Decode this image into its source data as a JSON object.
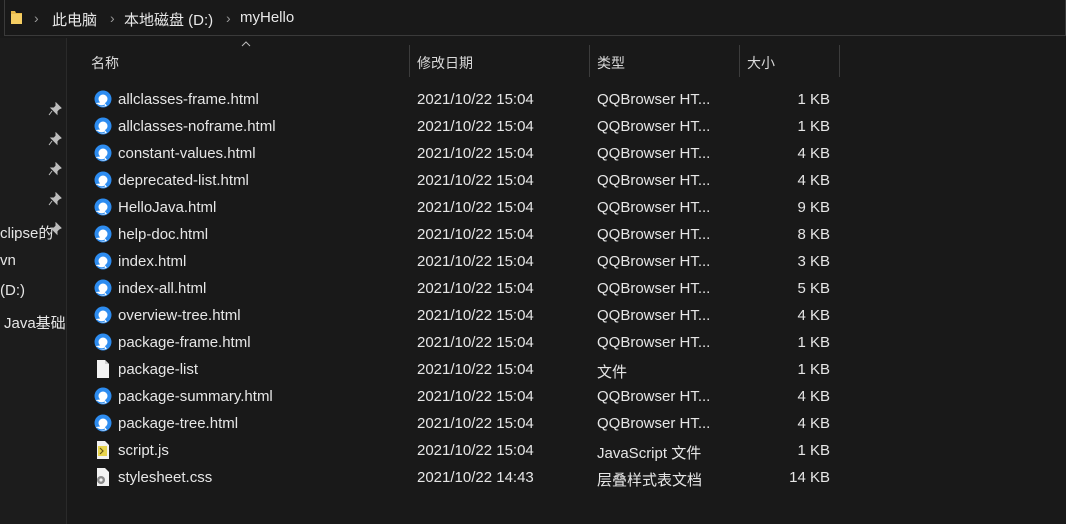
{
  "breadcrumb": [
    "此电脑",
    "本地磁盘 (D:)",
    "myHello"
  ],
  "nav_pane": {
    "items": [
      "clipse的",
      "vn",
      "(D:)",
      "Java基础."
    ]
  },
  "columns": {
    "name": "名称",
    "date": "修改日期",
    "type": "类型",
    "size": "大小"
  },
  "files": [
    {
      "name": "allclasses-frame.html",
      "date": "2021/10/22 15:04",
      "type": "QQBrowser HT...",
      "size": "1 KB",
      "icon": "qqbrowser-html-icon"
    },
    {
      "name": "allclasses-noframe.html",
      "date": "2021/10/22 15:04",
      "type": "QQBrowser HT...",
      "size": "1 KB",
      "icon": "qqbrowser-html-icon"
    },
    {
      "name": "constant-values.html",
      "date": "2021/10/22 15:04",
      "type": "QQBrowser HT...",
      "size": "4 KB",
      "icon": "qqbrowser-html-icon"
    },
    {
      "name": "deprecated-list.html",
      "date": "2021/10/22 15:04",
      "type": "QQBrowser HT...",
      "size": "4 KB",
      "icon": "qqbrowser-html-icon"
    },
    {
      "name": "HelloJava.html",
      "date": "2021/10/22 15:04",
      "type": "QQBrowser HT...",
      "size": "9 KB",
      "icon": "qqbrowser-html-icon"
    },
    {
      "name": "help-doc.html",
      "date": "2021/10/22 15:04",
      "type": "QQBrowser HT...",
      "size": "8 KB",
      "icon": "qqbrowser-html-icon"
    },
    {
      "name": "index.html",
      "date": "2021/10/22 15:04",
      "type": "QQBrowser HT...",
      "size": "3 KB",
      "icon": "qqbrowser-html-icon"
    },
    {
      "name": "index-all.html",
      "date": "2021/10/22 15:04",
      "type": "QQBrowser HT...",
      "size": "5 KB",
      "icon": "qqbrowser-html-icon"
    },
    {
      "name": "overview-tree.html",
      "date": "2021/10/22 15:04",
      "type": "QQBrowser HT...",
      "size": "4 KB",
      "icon": "qqbrowser-html-icon"
    },
    {
      "name": "package-frame.html",
      "date": "2021/10/22 15:04",
      "type": "QQBrowser HT...",
      "size": "1 KB",
      "icon": "qqbrowser-html-icon"
    },
    {
      "name": "package-list",
      "date": "2021/10/22 15:04",
      "type": "文件",
      "size": "1 KB",
      "icon": "blank-file-icon"
    },
    {
      "name": "package-summary.html",
      "date": "2021/10/22 15:04",
      "type": "QQBrowser HT...",
      "size": "4 KB",
      "icon": "qqbrowser-html-icon"
    },
    {
      "name": "package-tree.html",
      "date": "2021/10/22 15:04",
      "type": "QQBrowser HT...",
      "size": "4 KB",
      "icon": "qqbrowser-html-icon"
    },
    {
      "name": "script.js",
      "date": "2021/10/22 15:04",
      "type": "JavaScript 文件",
      "size": "1 KB",
      "icon": "javascript-file-icon"
    },
    {
      "name": "stylesheet.css",
      "date": "2021/10/22 14:43",
      "type": "层叠样式表文档",
      "size": "14 KB",
      "icon": "css-file-icon"
    }
  ]
}
